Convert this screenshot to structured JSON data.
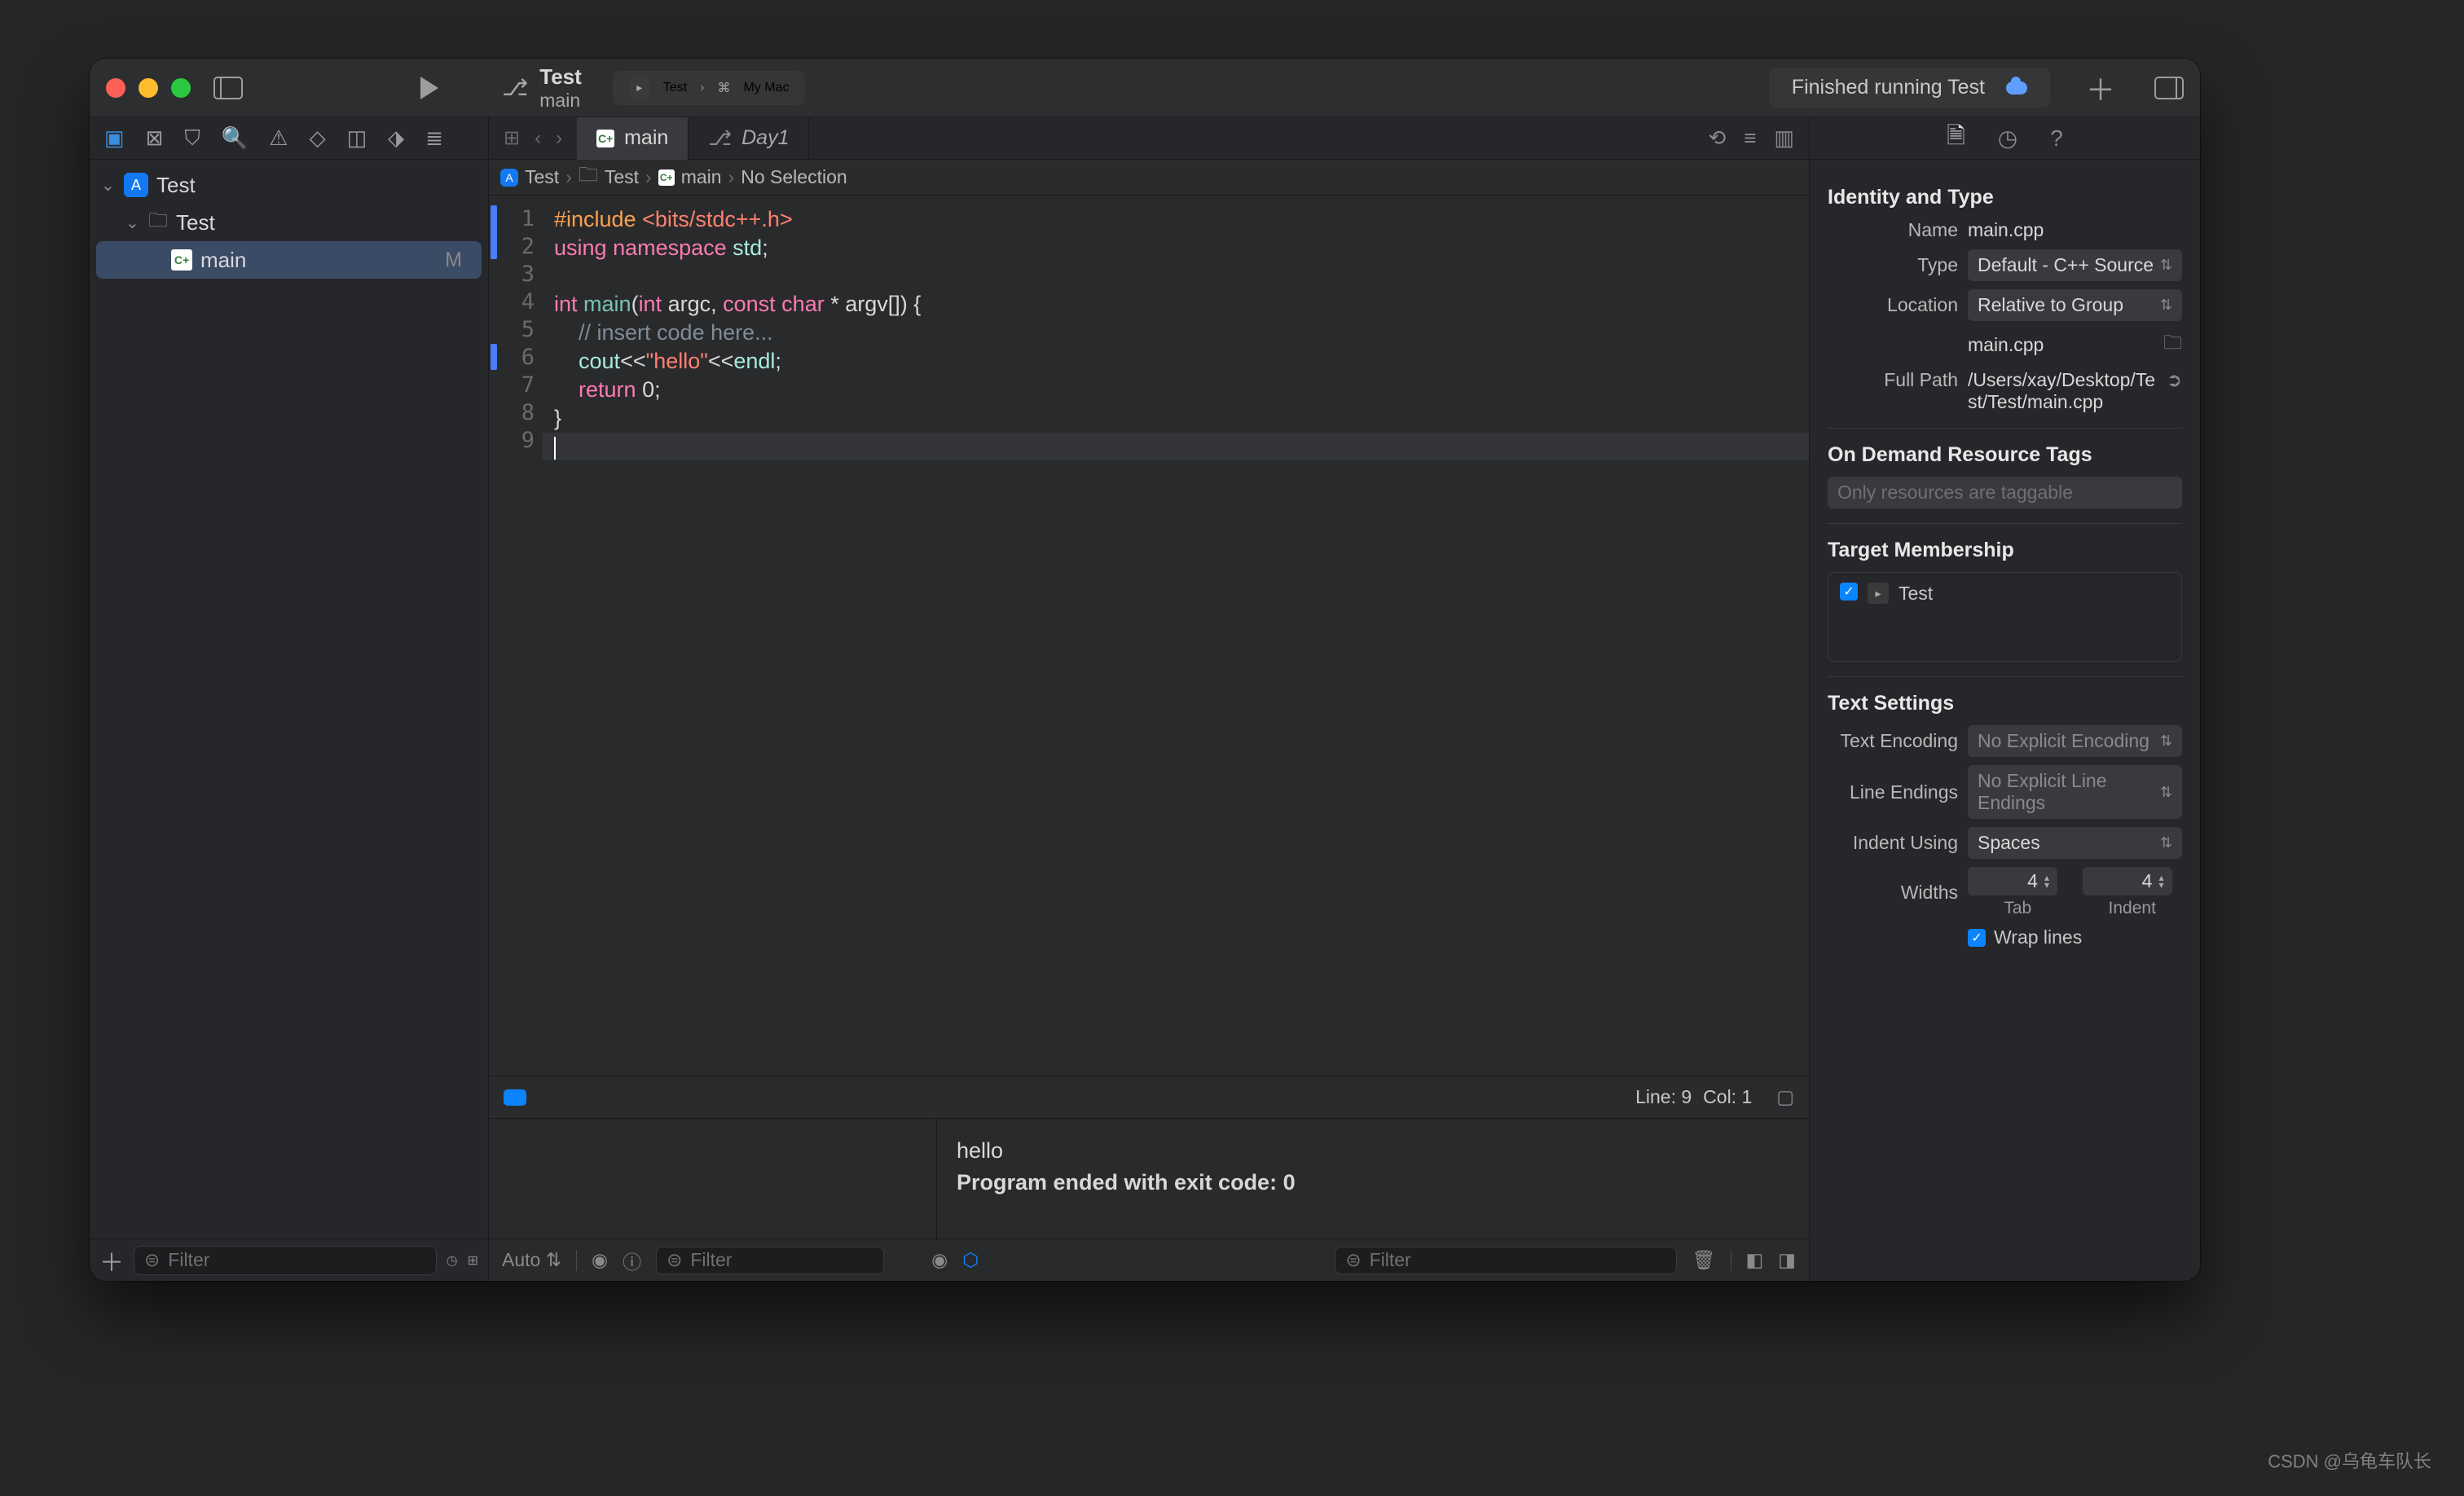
{
  "scheme": {
    "project": "Test",
    "branch": "main"
  },
  "target": {
    "name": "Test",
    "device": "My Mac"
  },
  "status": "Finished running Test",
  "tabs": [
    {
      "icon": "cpp",
      "label": "main"
    },
    {
      "icon": "git",
      "label": "Day1"
    }
  ],
  "jumpbar": {
    "root": "Test",
    "folder": "Test",
    "file": "main",
    "selection": "No Selection"
  },
  "code": {
    "lines": [
      1,
      2,
      3,
      4,
      5,
      6,
      7,
      8,
      9
    ],
    "l1a": "#include ",
    "l1b": "<bits/stdc++.h>",
    "l2a": "using ",
    "l2b": "namespace ",
    "l2c": "std",
    "l2d": ";",
    "l4a": "int ",
    "l4b": "main",
    "l4c": "(",
    "l4d": "int ",
    "l4e": "argc, ",
    "l4f": "const ",
    "l4g": "char ",
    "l4h": "* argv[]) {",
    "l5": "    // insert code here...",
    "l6a": "    ",
    "l6b": "cout",
    "l6c": "<<",
    "l6d": "\"hello\"",
    "l6e": "<<",
    "l6f": "endl",
    "l6g": ";",
    "l7a": "    ",
    "l7b": "return ",
    "l7c": "0;",
    "l8": "}"
  },
  "editor_status": {
    "line": "Line: 9",
    "col": "Col: 1"
  },
  "console": {
    "out1": "hello",
    "out2": "Program ended with exit code: 0"
  },
  "debug": {
    "auto": "Auto ⇅",
    "filter": "Filter"
  },
  "navigator": {
    "project": "Test",
    "folder": "Test",
    "file": "main",
    "modified": "M",
    "filter": "Filter"
  },
  "inspector": {
    "s1": "Identity and Type",
    "name_l": "Name",
    "name_v": "main.cpp",
    "type_l": "Type",
    "type_v": "Default - C++ Source",
    "loc_l": "Location",
    "loc_v": "Relative to Group",
    "loc_file": "main.cpp",
    "fp_l": "Full Path",
    "fp_v": "/Users/xay/Desktop/Test/Test/main.cpp",
    "s2": "On Demand Resource Tags",
    "tags_ph": "Only resources are taggable",
    "s3": "Target Membership",
    "tgt": "Test",
    "s4": "Text Settings",
    "enc_l": "Text Encoding",
    "enc_v": "No Explicit Encoding",
    "le_l": "Line Endings",
    "le_v": "No Explicit Line Endings",
    "ind_l": "Indent Using",
    "ind_v": "Spaces",
    "w_l": "Widths",
    "tab_v": "4",
    "ind_v2": "4",
    "tab_sub": "Tab",
    "ind_sub": "Indent",
    "wrap": "Wrap lines"
  },
  "watermark": "CSDN @乌龟车队长"
}
